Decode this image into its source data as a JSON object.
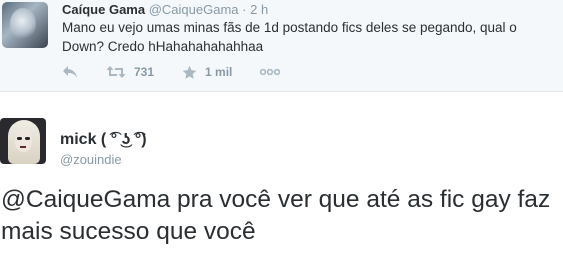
{
  "quoted_tweet": {
    "display_name": "Caíque Gama",
    "handle": "@CaiqueGama",
    "separator": "·",
    "time": "2 h",
    "text": "Mano eu vejo umas minas fãs de 1d postando fics deles se pegando, qual o Down? Credo hHahahahahahhaa",
    "retweets": "731",
    "favorites": "1 mil"
  },
  "reply_tweet": {
    "display_name": "mick ( ͡° ͜ʖ ͡°)",
    "handle": "@zouindie",
    "mention": "@CaiqueGama",
    "text": " pra você ver que até as fic gay faz mais sucesso que você"
  },
  "colors": {
    "icon_gray": "#aab8c2",
    "secondary_text": "#8899a6",
    "primary_text": "#292f33",
    "quoted_background": "#f5f8fa"
  }
}
